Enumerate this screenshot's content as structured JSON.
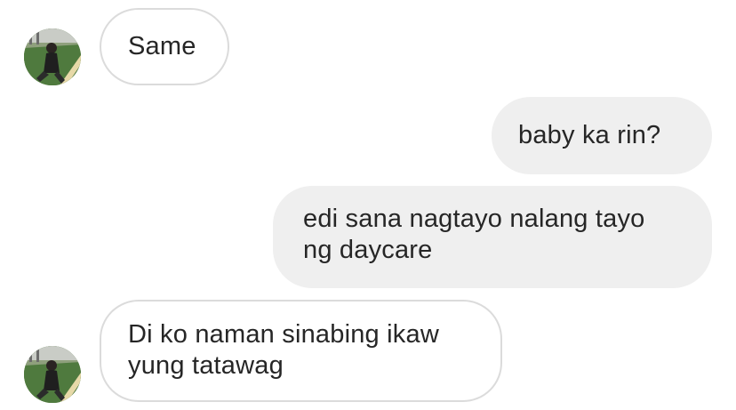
{
  "chat": {
    "messages": [
      {
        "direction": "received",
        "text": "Same"
      },
      {
        "direction": "sent",
        "text": "baby ka rin?"
      },
      {
        "direction": "sent",
        "text": "edi sana nagtayo nalang tayo\nng daycare"
      },
      {
        "direction": "received",
        "text": "Di ko naman sinabing ikaw\nyung tatawag"
      }
    ],
    "contact": {
      "avatar_icon": "profile-photo-avatar"
    }
  },
  "colors": {
    "sent_bubble_bg": "#efefef",
    "received_bubble_border": "#dbdbdb",
    "text": "#262626"
  }
}
